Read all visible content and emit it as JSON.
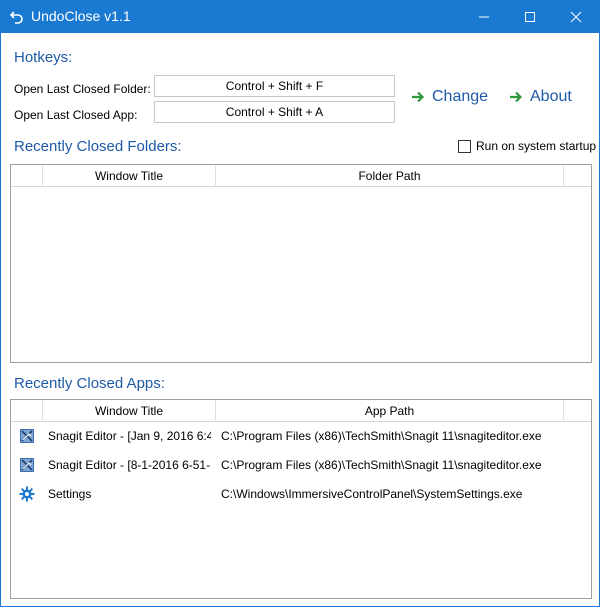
{
  "window": {
    "title": "UndoClose v1.1"
  },
  "hotkeys": {
    "section_title": "Hotkeys:",
    "folder_label": "Open Last Closed Folder:",
    "folder_value": "Control + Shift + F",
    "app_label": "Open Last Closed App:",
    "app_value": "Control + Shift + A",
    "change_label": "Change",
    "about_label": "About"
  },
  "folders": {
    "section_title": "Recently Closed Folders:",
    "startup_label": "Run on system startup",
    "startup_checked": false,
    "columns": [
      "Window Title",
      "Folder Path"
    ],
    "rows": []
  },
  "apps": {
    "section_title": "Recently Closed Apps:",
    "columns": [
      "Window Title",
      "App Path"
    ],
    "rows": [
      {
        "icon": "snagit-icon",
        "title": "Snagit Editor - [Jan 9, 2016 6:4:",
        "path": "C:\\Program Files (x86)\\TechSmith\\Snagit 11\\snagiteditor.exe"
      },
      {
        "icon": "snagit-icon",
        "title": "Snagit Editor - [8-1-2016 6-51-",
        "path": "C:\\Program Files (x86)\\TechSmith\\Snagit 11\\snagiteditor.exe"
      },
      {
        "icon": "gear-icon",
        "title": "Settings",
        "path": "C:\\Windows\\ImmersiveControlPanel\\SystemSettings.exe"
      }
    ]
  },
  "colors": {
    "titlebar": "#1a79d1",
    "accent_text": "#1e5aa8",
    "arrow": "#2e9a3a"
  }
}
